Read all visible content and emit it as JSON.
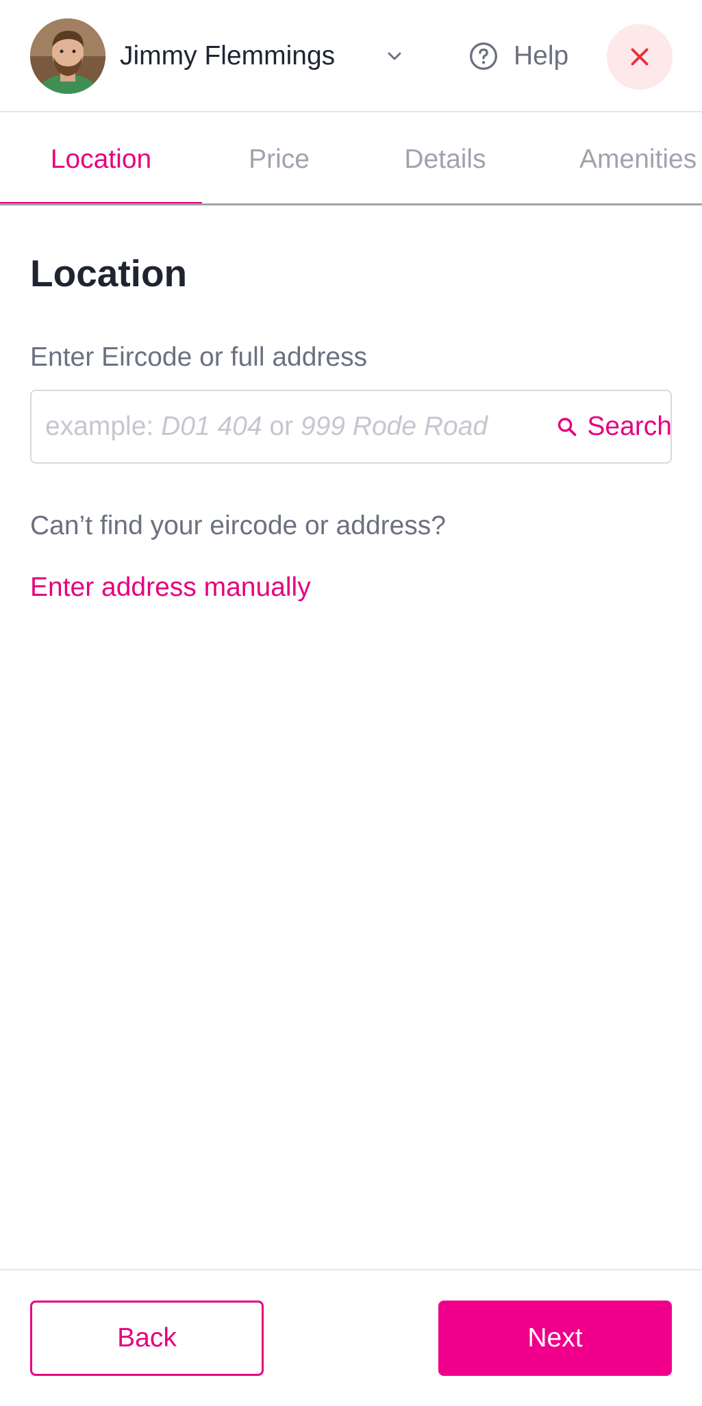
{
  "header": {
    "user_name": "Jimmy Flemmings",
    "help_label": "Help",
    "icons": {
      "avatar": "user-avatar-photo",
      "chevron": "chevron-down-icon",
      "help": "question-circle-icon",
      "close": "close-icon"
    }
  },
  "tabs": [
    {
      "label": "Location",
      "active": true
    },
    {
      "label": "Price",
      "active": false
    },
    {
      "label": "Details",
      "active": false
    },
    {
      "label": "Amenities",
      "active": false
    }
  ],
  "main": {
    "title": "Location",
    "field_label": "Enter Eircode or full address",
    "search": {
      "placeholder_prefix": "example: ",
      "placeholder_example_1": "D01 404",
      "placeholder_or": " or ",
      "placeholder_example_2": "999 Rode Road",
      "button_label": "Search"
    },
    "hint": "Can’t find your eircode or address?",
    "manual_link": "Enter address manually"
  },
  "footer": {
    "back_label": "Back",
    "next_label": "Next"
  },
  "colors": {
    "accent": "#e6007e",
    "primary_button": "#f0008a",
    "close_bg": "#fde8ea",
    "close_icon": "#e8323c",
    "muted_text": "#6b7080",
    "tab_inactive": "#9ea3ad"
  }
}
